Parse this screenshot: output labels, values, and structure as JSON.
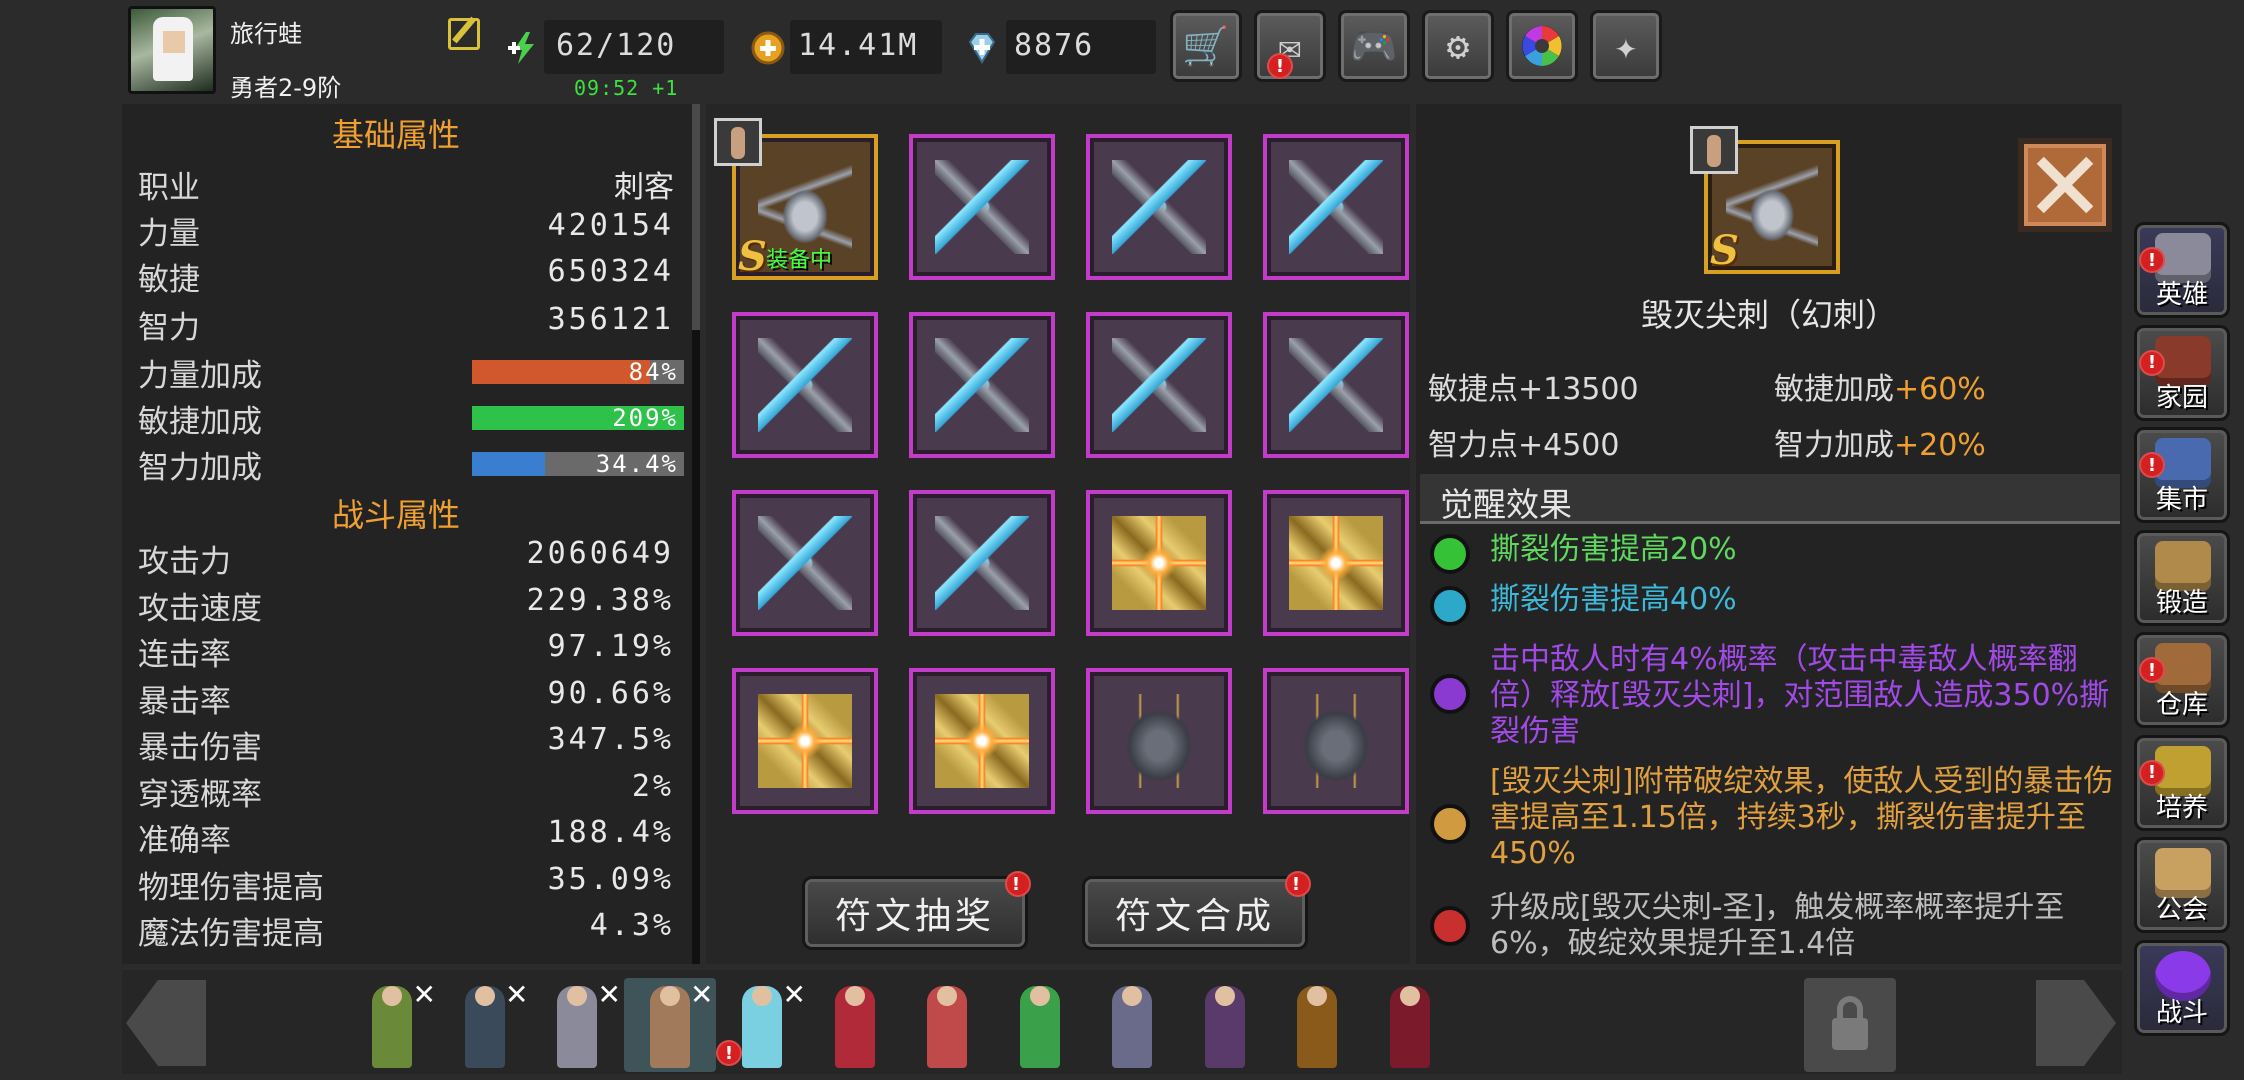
{
  "player": {
    "name": "旅行蛙",
    "rank": "勇者2-9阶",
    "avatar_icon": "hero-portrait-icon",
    "edit_icon": "edit-icon"
  },
  "resources": {
    "energy": {
      "icon": "energy-plus-icon",
      "value": "62/120",
      "timer": "09:52 +1"
    },
    "gold": {
      "icon": "gold-coin-plus-icon",
      "value": "14.41M"
    },
    "gems": {
      "icon": "gem-plus-icon",
      "value": "8876"
    }
  },
  "toolbar": [
    {
      "name": "shop-button",
      "icon": "cart-icon",
      "glyph": "🛒",
      "badge": false
    },
    {
      "name": "mail-button",
      "icon": "mail-icon",
      "glyph": "✉",
      "badge": true
    },
    {
      "name": "gamepad-button",
      "icon": "gamepad-icon",
      "glyph": "🎮",
      "badge": false
    },
    {
      "name": "settings-button",
      "icon": "gear-icon",
      "glyph": "⚙",
      "badge": false
    },
    {
      "name": "color-wheel-button",
      "icon": "color-wheel-icon",
      "glyph": "◉",
      "badge": false
    },
    {
      "name": "share-button",
      "icon": "share-icon",
      "glyph": "✦",
      "badge": false
    }
  ],
  "stats": {
    "basic_title": "基础属性",
    "combat_title": "战斗属性",
    "basic": [
      {
        "label": "职业",
        "value": "刺客"
      },
      {
        "label": "力量",
        "value": "420154"
      },
      {
        "label": "敏捷",
        "value": "650324"
      },
      {
        "label": "智力",
        "value": "356121"
      }
    ],
    "bars": [
      {
        "label": "力量加成",
        "value": "84%",
        "fill": 0.84,
        "color": "#d0582c"
      },
      {
        "label": "敏捷加成",
        "value": "209%",
        "fill": 1.0,
        "color": "#2ec24a"
      },
      {
        "label": "智力加成",
        "value": "34.4%",
        "fill": 0.344,
        "color": "#3a7ed0"
      }
    ],
    "combat": [
      {
        "label": "攻击力",
        "value": "2060649"
      },
      {
        "label": "攻击速度",
        "value": "229.38%"
      },
      {
        "label": "连击率",
        "value": "97.19%"
      },
      {
        "label": "暴击率",
        "value": "90.66%"
      },
      {
        "label": "暴击伤害",
        "value": "347.5%"
      },
      {
        "label": "穿透概率",
        "value": "2%"
      },
      {
        "label": "准确率",
        "value": "188.4%"
      },
      {
        "label": "物理伤害提高",
        "value": "35.09%"
      },
      {
        "label": "魔法伤害提高",
        "value": "4.3%"
      }
    ]
  },
  "runes": {
    "equipped_label": "装备中",
    "grade": "S",
    "grid": [
      "winged",
      "blade",
      "blade",
      "blade",
      "blade",
      "blade",
      "blade",
      "blade",
      "blade",
      "blade",
      "star",
      "star",
      "star",
      "star",
      "shield",
      "shield"
    ],
    "draw_button": "符文抽奖",
    "merge_button": "符文合成"
  },
  "detail": {
    "name": "毁灭尖刺（幻刺）",
    "grade": "S",
    "bonuses": [
      {
        "label": "敏捷点+13500",
        "extra": ""
      },
      {
        "label": "敏捷加成",
        "extra": "+60%"
      },
      {
        "label": "智力点+4500",
        "extra": ""
      },
      {
        "label": "智力加成",
        "extra": "+20%"
      }
    ],
    "awaken_title": "觉醒效果",
    "awaken": [
      {
        "color": "#36c236",
        "text_color": "#5ed85e",
        "text": "撕裂伤害提高20%"
      },
      {
        "color": "#2ea8c8",
        "text_color": "#3eb8d8",
        "text": "撕裂伤害提高40%"
      },
      {
        "color": "#8a3ad0",
        "text_color": "#a24ae8",
        "text": "击中敌人时有4%概率（攻击中毒敌人概率翻倍）释放[毁灭尖刺]，对范围敌人造成350%撕裂伤害"
      },
      {
        "color": "#d09a40",
        "text_color": "#e0a040",
        "text": "[毁灭尖刺]附带破绽效果，使敌人受到的暴击伤害提高至1.15倍，持续3秒，撕裂伤害提升至450%"
      },
      {
        "color": "#c83030",
        "text_color": "#bdbdbd",
        "text": "升级成[毁灭尖刺-圣]，触发概率概率提升至6%，破绽效果提升至1.4倍"
      }
    ]
  },
  "nav": [
    {
      "label": "英雄",
      "icon": "helmet-icon",
      "badge": true,
      "color": "#8a8a9a"
    },
    {
      "label": "家园",
      "icon": "castle-icon",
      "badge": true,
      "color": "#8a3a2a"
    },
    {
      "label": "集市",
      "icon": "market-icon",
      "badge": true,
      "color": "#4a6ab0"
    },
    {
      "label": "锻造",
      "icon": "anvil-icon",
      "badge": false,
      "color": "#b08a4a"
    },
    {
      "label": "仓库",
      "icon": "warehouse-icon",
      "badge": true,
      "color": "#a06a3a"
    },
    {
      "label": "培养",
      "icon": "chalice-icon",
      "badge": true,
      "color": "#c0a030"
    },
    {
      "label": "公会",
      "icon": "guild-icon",
      "badge": false,
      "color": "#c8a060"
    },
    {
      "label": "战斗",
      "icon": "portal-icon",
      "badge": false,
      "color": "#8a3ae8"
    }
  ],
  "heroes": [
    {
      "name": "hero-archer",
      "color": "#6a8a3a",
      "crossed": true,
      "badge": false,
      "selected": false
    },
    {
      "name": "hero-warrior",
      "color": "#3a4a5a",
      "crossed": true,
      "badge": false,
      "selected": false
    },
    {
      "name": "hero-swordsman",
      "color": "#8a8a9a",
      "crossed": true,
      "badge": false,
      "selected": false
    },
    {
      "name": "hero-assassin",
      "color": "#a07a5a",
      "crossed": true,
      "badge": false,
      "selected": true
    },
    {
      "name": "hero-spirit",
      "color": "#7ad0e0",
      "crossed": true,
      "badge": true,
      "selected": false
    },
    {
      "name": "hero-mage-red",
      "color": "#b02a3a",
      "crossed": false,
      "badge": false,
      "selected": false
    },
    {
      "name": "hero-gunner",
      "color": "#c04a4a",
      "crossed": false,
      "badge": false,
      "selected": false
    },
    {
      "name": "hero-druid",
      "color": "#3aa04a",
      "crossed": false,
      "badge": false,
      "selected": false
    },
    {
      "name": "hero-witch",
      "color": "#6a6a8a",
      "crossed": false,
      "badge": false,
      "selected": false
    },
    {
      "name": "hero-shaman",
      "color": "#5a3a6a",
      "crossed": false,
      "badge": false,
      "selected": false
    },
    {
      "name": "hero-knight",
      "color": "#8a5a1a",
      "crossed": false,
      "badge": false,
      "selected": false
    },
    {
      "name": "hero-dark",
      "color": "#7a1a2a",
      "crossed": false,
      "badge": false,
      "selected": false
    }
  ],
  "hero_locked_icon": "lock-icon",
  "badge_mark": "!",
  "cross_mark": "✕"
}
